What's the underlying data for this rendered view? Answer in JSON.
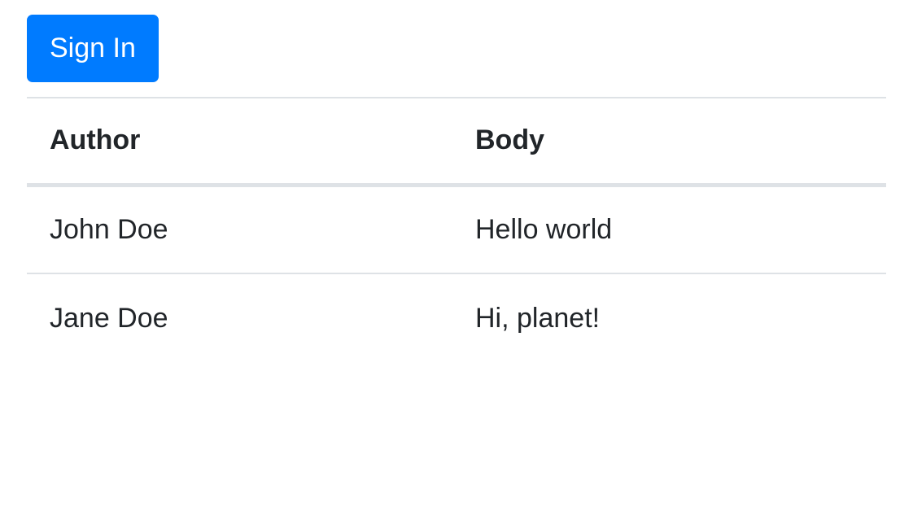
{
  "sign_in": {
    "label": "Sign In"
  },
  "table": {
    "headers": [
      "Author",
      "Body"
    ],
    "rows": [
      [
        "John Doe",
        "Hello world"
      ],
      [
        "Jane Doe",
        "Hi, planet!"
      ]
    ]
  },
  "colors": {
    "primary": "#007bff",
    "border": "#dee2e6",
    "text": "#212529"
  }
}
